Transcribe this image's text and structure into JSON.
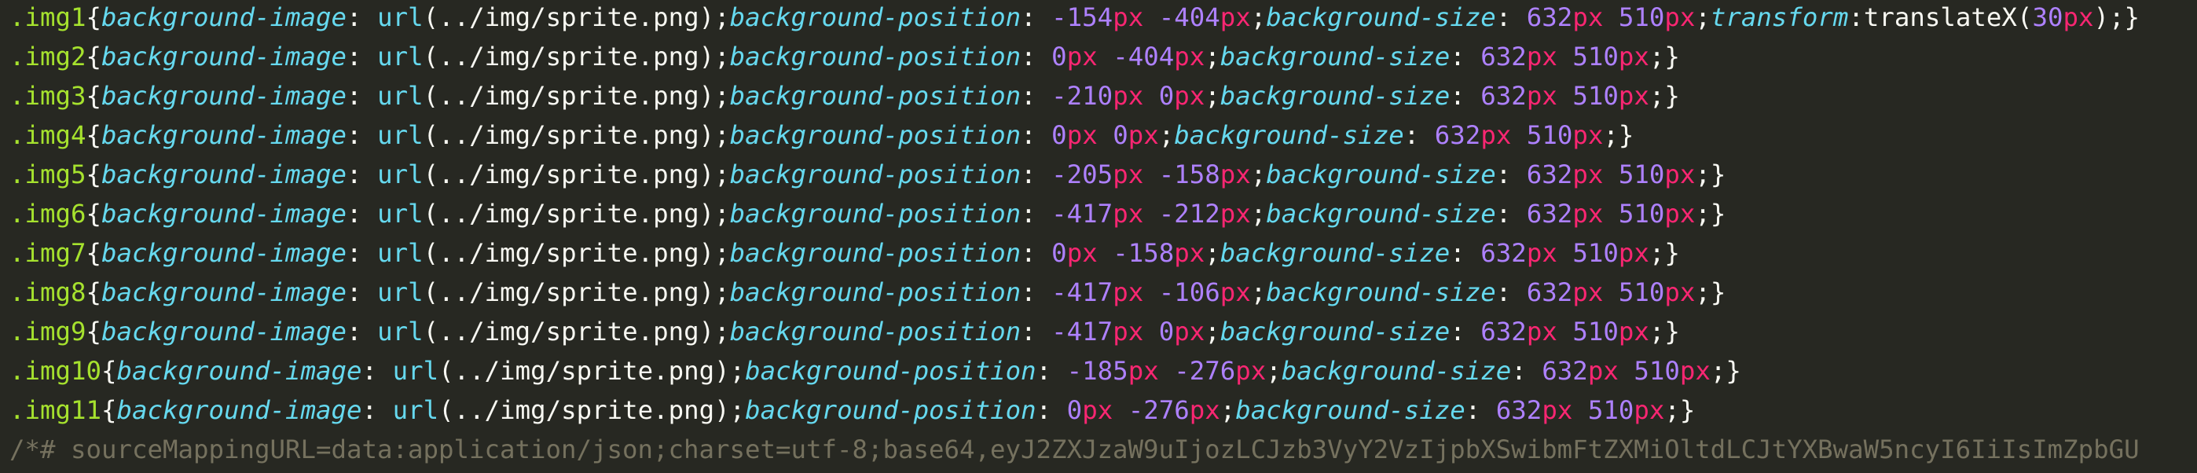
{
  "theme": {
    "background": "#272822",
    "selector": "#a6e22e",
    "property": "#66d9ef",
    "number": "#ae81ff",
    "unit": "#f92672",
    "text": "#f8f8f2",
    "comment": "#75715e"
  },
  "lines": [
    {
      "kind": "rule",
      "selector": ".img1",
      "pos_x": "-154",
      "pos_y": "-404",
      "size_w": "632",
      "size_h": "510",
      "transform_fn": "translateX",
      "transform_val": "30"
    },
    {
      "kind": "rule",
      "selector": ".img2",
      "pos_x": "0",
      "pos_y": "-404",
      "size_w": "632",
      "size_h": "510"
    },
    {
      "kind": "rule",
      "selector": ".img3",
      "pos_x": "-210",
      "pos_y": "0",
      "size_w": "632",
      "size_h": "510"
    },
    {
      "kind": "rule",
      "selector": ".img4",
      "pos_x": "0",
      "pos_y": "0",
      "size_w": "632",
      "size_h": "510"
    },
    {
      "kind": "rule",
      "selector": ".img5",
      "pos_x": "-205",
      "pos_y": "-158",
      "size_w": "632",
      "size_h": "510"
    },
    {
      "kind": "rule",
      "selector": ".img6",
      "pos_x": "-417",
      "pos_y": "-212",
      "size_w": "632",
      "size_h": "510"
    },
    {
      "kind": "rule",
      "selector": ".img7",
      "pos_x": "0",
      "pos_y": "-158",
      "size_w": "632",
      "size_h": "510"
    },
    {
      "kind": "rule",
      "selector": ".img8",
      "pos_x": "-417",
      "pos_y": "-106",
      "size_w": "632",
      "size_h": "510"
    },
    {
      "kind": "rule",
      "selector": ".img9",
      "pos_x": "-417",
      "pos_y": "0",
      "size_w": "632",
      "size_h": "510"
    },
    {
      "kind": "rule",
      "selector": ".img10",
      "pos_x": "-185",
      "pos_y": "-276",
      "size_w": "632",
      "size_h": "510"
    },
    {
      "kind": "rule",
      "selector": ".img11",
      "pos_x": "0",
      "pos_y": "-276",
      "size_w": "632",
      "size_h": "510"
    },
    {
      "kind": "comment",
      "text": "/*# sourceMappingURL=data:application/json;charset=utf-8;base64,eyJ2ZXJzaW9uIjozLCJzb3VyY2VzIjpbXSwibmFtZXMiOltdLCJtYXBwaW5ncyI6IiIsImZpbGU"
    }
  ],
  "tokens": {
    "open_brace": "{",
    "close_brace": "}",
    "colon": ":",
    "colon_space": ": ",
    "semicolon": ";",
    "space": " ",
    "prop_bg_image": "background-image",
    "fn_url": "url",
    "url_open": "(",
    "url_path": "../img/sprite.png",
    "url_close": ")",
    "prop_bg_position": "background-position",
    "prop_bg_size": "background-size",
    "prop_transform": "transform",
    "paren_open": "(",
    "paren_close": ")",
    "unit_px": "px"
  }
}
